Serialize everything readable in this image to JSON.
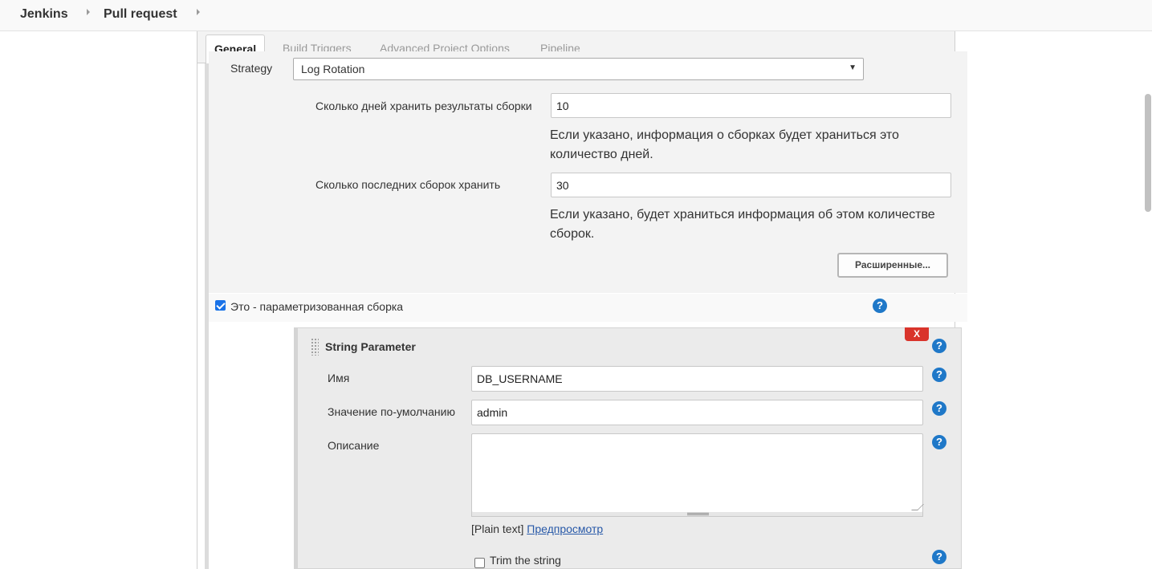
{
  "breadcrumb": {
    "items": [
      "Jenkins",
      "Pull request"
    ]
  },
  "tabs": [
    {
      "label": "General",
      "active": true
    },
    {
      "label": "Build Triggers",
      "active": false
    },
    {
      "label": "Advanced Project Options",
      "active": false
    },
    {
      "label": "Pipeline",
      "active": false
    }
  ],
  "discard": {
    "strategy_label": "Strategy",
    "strategy_value": "Log Rotation",
    "days_label": "Сколько дней хранить результаты сборки",
    "days_value": "10",
    "days_help_line1": "Если указано, информация о сборках будет храниться это",
    "days_help_line2": "количество дней.",
    "builds_label": "Сколько последних сборок хранить",
    "builds_value": "30",
    "builds_help_line1": "Если указано, будет храниться информация об этом количестве",
    "builds_help_line2": "сборок.",
    "advanced_button": "Расширенные..."
  },
  "parameterized": {
    "checkbox_label": "Это - параметризованная сборка",
    "checked": true
  },
  "string_param": {
    "title": "String Parameter",
    "delete_label": "X",
    "name_label": "Имя",
    "name_value": "DB_USERNAME",
    "default_label": "Значение по-умолчанию",
    "default_value": "admin",
    "description_label": "Описание",
    "description_value": "",
    "format_prefix": "[Plain text]",
    "preview_link": "Предпросмотр",
    "trim_label": "Trim the string",
    "trim_checked": false
  },
  "help_glyph": "?",
  "colors": {
    "accent": "#1f78c8",
    "danger": "#d9342b",
    "link": "#2859a8"
  }
}
